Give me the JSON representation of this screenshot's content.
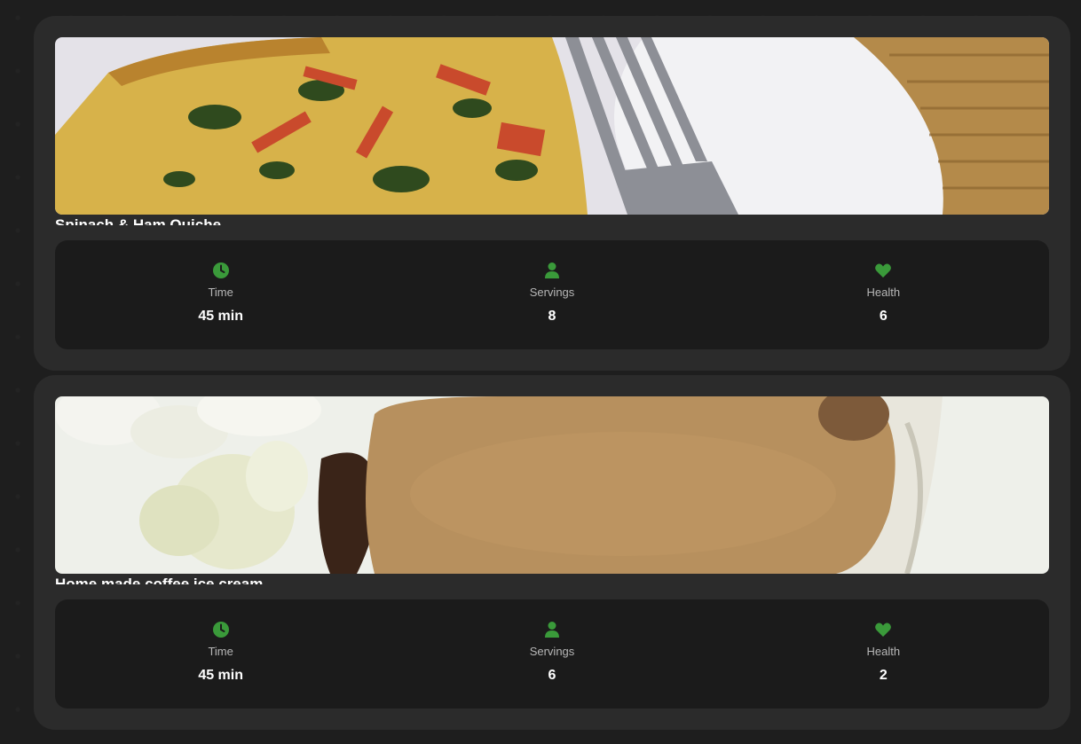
{
  "colors": {
    "accent": "#3a9a3a",
    "card_bg": "#2b2b2b",
    "stats_bg": "#1b1b1b",
    "page_bg": "#1e1e1e"
  },
  "recipes": [
    {
      "title": "Spinach & Ham Quiche",
      "image": "quiche-photo",
      "stats": [
        {
          "icon": "clock-icon",
          "label": "Time",
          "value": "45 min"
        },
        {
          "icon": "person-icon",
          "label": "Servings",
          "value": "8"
        },
        {
          "icon": "heart-icon",
          "label": "Health",
          "value": "6"
        }
      ]
    },
    {
      "title": "Home made coffee ice cream",
      "image": "coffee-ice-cream-photo",
      "stats": [
        {
          "icon": "clock-icon",
          "label": "Time",
          "value": "45 min"
        },
        {
          "icon": "person-icon",
          "label": "Servings",
          "value": "6"
        },
        {
          "icon": "heart-icon",
          "label": "Health",
          "value": "2"
        }
      ]
    }
  ]
}
